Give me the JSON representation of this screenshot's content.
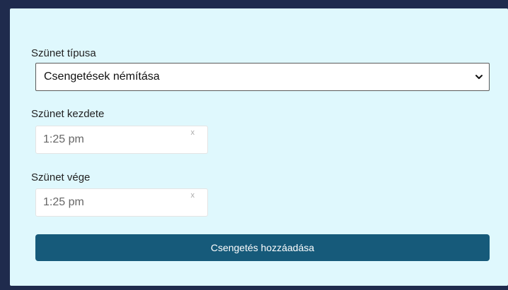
{
  "form": {
    "break_type": {
      "label": "Szünet típusa",
      "selected": "Csengetések némítása"
    },
    "break_start": {
      "label": "Szünet kezdete",
      "value": "1:25 pm",
      "clear": "x"
    },
    "break_end": {
      "label": "Szünet vége",
      "value": "1:25 pm",
      "clear": "x"
    },
    "submit_label": "Csengetés hozzáadása"
  },
  "colors": {
    "frame": "#1f2b4d",
    "panel": "#dff8fd",
    "button": "#165a7a"
  },
  "icons": {
    "select_arrow": "chevron-down-icon",
    "clear": "close-icon"
  }
}
